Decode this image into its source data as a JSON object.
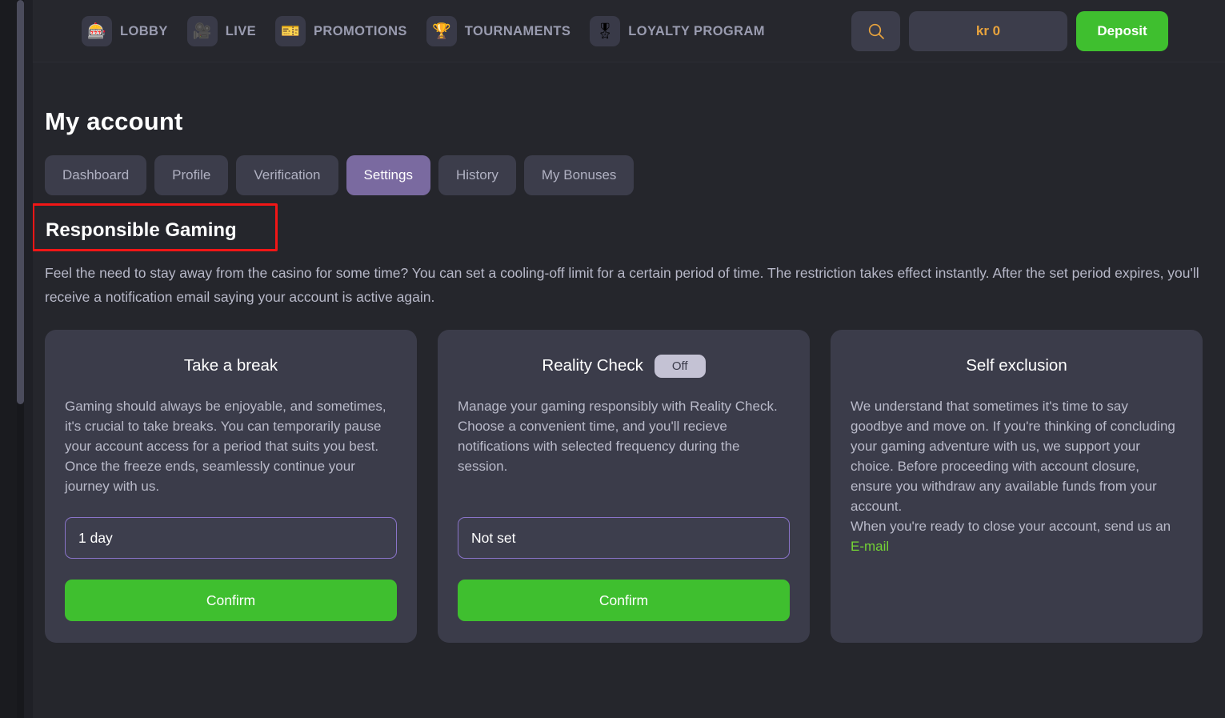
{
  "header": {
    "nav": [
      {
        "icon": "slot-machine-icon",
        "glyph": "🎰",
        "label": "LOBBY"
      },
      {
        "icon": "live-dealer-icon",
        "glyph": "🎥",
        "label": "LIVE"
      },
      {
        "icon": "ticket-icon",
        "glyph": "🎫",
        "label": "PROMOTIONS"
      },
      {
        "icon": "trophy-icon",
        "glyph": "🏆",
        "label": "TOURNAMENTS"
      },
      {
        "icon": "laurel-medal-icon",
        "glyph": "🎖",
        "label": "LOYALTY PROGRAM"
      }
    ],
    "search_icon": "search-icon",
    "balance": "kr 0",
    "deposit_label": "Deposit"
  },
  "page": {
    "title": "My account",
    "tabs": [
      {
        "label": "Dashboard",
        "active": false
      },
      {
        "label": "Profile",
        "active": false
      },
      {
        "label": "Verification",
        "active": false
      },
      {
        "label": "Settings",
        "active": true
      },
      {
        "label": "History",
        "active": false
      },
      {
        "label": "My Bonuses",
        "active": false
      }
    ],
    "section_title": "Responsible Gaming",
    "section_description": "Feel the need to stay away from the casino for some time? You can set a cooling-off limit for a certain period of time. The restriction takes effect instantly. After the set period expires, you'll receive a notification email saying your account is active again."
  },
  "cards": {
    "take_a_break": {
      "title": "Take a break",
      "body": "Gaming should always be enjoyable, and sometimes, it's crucial to take breaks. You can temporarily pause your account access for a period that suits you best. Once the freeze ends, seamlessly continue your journey with us.",
      "select_value": "1 day",
      "confirm_label": "Confirm"
    },
    "reality_check": {
      "title": "Reality Check",
      "toggle_label": "Off",
      "body": "Manage your gaming responsibly with Reality Check. Choose a convenient time, and you'll recieve notifications with selected frequency during the session.",
      "select_value": "Not set",
      "confirm_label": "Confirm"
    },
    "self_exclusion": {
      "title": "Self exclusion",
      "body_part1": "We understand that sometimes it's time to say goodbye and move on. If you're thinking of concluding your gaming adventure with us, we support your choice. Before proceeding with account closure, ensure you withdraw any available funds from your account.",
      "body_part2": "When you're ready to close your account, send us an ",
      "email_link_label": "E-mail"
    }
  },
  "annotation": {
    "highlight_color": "#f21616",
    "highlight_target": "Responsible Gaming"
  },
  "colors": {
    "page_background": "#25262c",
    "card_background": "#3b3c4a",
    "accent_green": "#3fbf2f",
    "accent_purple": "#7a6aa0",
    "balance_gold": "#e8a33d",
    "link_green": "#74d435"
  }
}
